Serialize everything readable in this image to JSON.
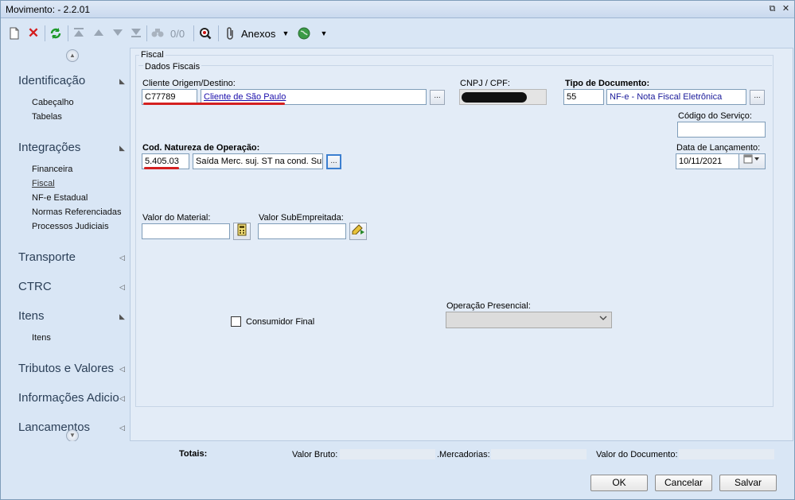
{
  "window": {
    "title": "Movimento:  - 2.2.01",
    "restore_glyph": "⧉",
    "close_glyph": "✕"
  },
  "toolbar": {
    "new_icon": "new-document-icon",
    "delete_icon": "delete-icon",
    "refresh_icon": "refresh-icon",
    "first_icon": "first-record-icon",
    "prev_icon": "previous-record-icon",
    "next_icon": "next-record-icon",
    "last_icon": "last-record-icon",
    "find_icon": "binoculars-icon",
    "record_counter": "0/0",
    "search_icon": "search-icon",
    "attachments_label": "Anexos",
    "globe_icon": "globe-icon"
  },
  "sidebar": {
    "sections": [
      {
        "title": "Identificação",
        "items": [
          "Cabeçalho",
          "Tabelas"
        ]
      },
      {
        "title": "Integrações",
        "items": [
          "Financeira",
          "Fiscal",
          "NF-e Estadual",
          "Normas Referenciadas",
          "Processos Judiciais"
        ]
      },
      {
        "title": "Transporte",
        "items": []
      },
      {
        "title": "CTRC",
        "items": []
      },
      {
        "title": "Itens",
        "items": [
          "Itens"
        ]
      },
      {
        "title": "Tributos e Valores",
        "items": []
      },
      {
        "title": "Informações Adicio",
        "items": []
      },
      {
        "title": "Lancamentos",
        "items": []
      }
    ]
  },
  "form": {
    "group_fiscal": "Fiscal",
    "group_dados": "Dados Fiscais",
    "cliente_label": "Cliente Origem/Destino:",
    "cliente_code": "C77789",
    "cliente_name": "Cliente de São Paulo",
    "cnpj_label": "CNPJ / CPF:",
    "tipo_doc_label": "Tipo de Documento:",
    "tipo_doc_code": "55",
    "tipo_doc_name": "NF-e - Nota Fiscal Eletrônica",
    "codigo_servico_label": "Código do Serviço:",
    "codigo_servico_value": "",
    "natureza_label": "Cod. Natureza de Operação:",
    "natureza_code": "5.405.03",
    "natureza_desc": "Saída Merc. suj. ST na cond. Sub",
    "data_lanc_label": "Data de Lançamento:",
    "data_lanc_value": "10/11/2021",
    "valor_material_label": "Valor do Material:",
    "valor_material_value": "",
    "valor_sub_label": "Valor SubEmpreitada:",
    "valor_sub_value": "",
    "consumidor_final_label": "Consumidor Final",
    "consumidor_final_checked": false,
    "operacao_presencial_label": "Operação Presencial:",
    "operacao_presencial_value": "",
    "dots": "..."
  },
  "totals": {
    "label": "Totais:",
    "valor_bruto_label": "Valor Bruto:",
    "mercadorias_label": ".Mercadorias:",
    "valor_documento_label": "Valor do Documento:"
  },
  "buttons": {
    "ok": "OK",
    "cancel": "Cancelar",
    "save": "Salvar"
  },
  "colors": {
    "accent": "#3c7fd0",
    "annotation": "#d42020",
    "background": "#d9e6f5"
  }
}
